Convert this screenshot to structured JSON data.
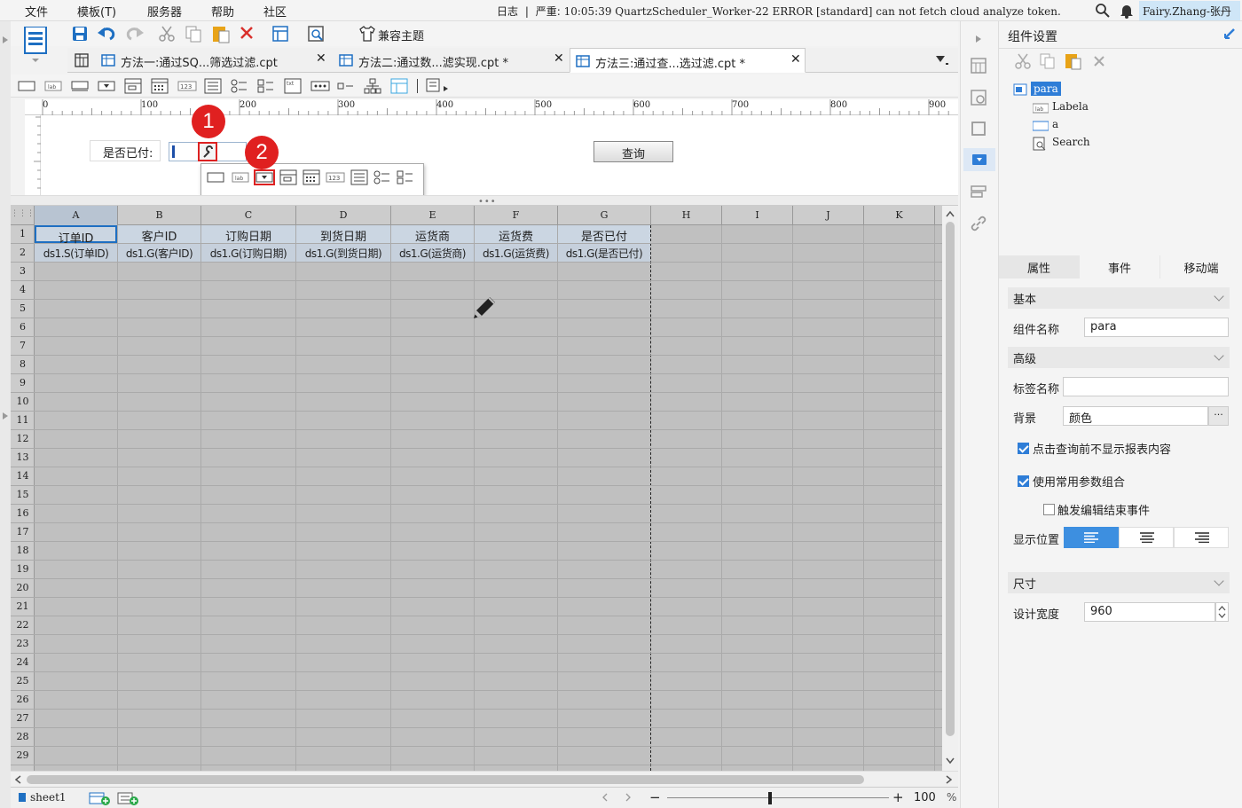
{
  "menubar": {
    "items": [
      "文件",
      "模板(T)",
      "服务器",
      "帮助",
      "社区"
    ],
    "log_label": "日志",
    "severity": "严重:",
    "log_message": "10:05:39 QuartzScheduler_Worker-22 ERROR [standard] can not fetch cloud analyze token.",
    "user": "Fairy.Zhang-张丹"
  },
  "toolbar": {
    "theme_label": "兼容主题"
  },
  "tabs": [
    {
      "label": "方法一:通过SQ...筛选过滤.cpt"
    },
    {
      "label": "方法二:通过数...滤实现.cpt *"
    },
    {
      "label": "方法三:通过查...选过滤.cpt *"
    }
  ],
  "ruler": {
    "marks": [
      "0",
      "100",
      "200",
      "300",
      "400",
      "500",
      "600",
      "700",
      "800",
      "900"
    ]
  },
  "param_area": {
    "label": "是否已付:",
    "query_button": "查询"
  },
  "widget_popup": {
    "row1": [
      "text-box",
      "label",
      "dropdown",
      "multi-select",
      "date",
      "number",
      "list",
      "radio-group",
      "checkbox-group"
    ],
    "row2": [
      "textarea",
      "password",
      "checkbox",
      "tree",
      "table-tree"
    ]
  },
  "badges": [
    "1",
    "2"
  ],
  "grid": {
    "columns": [
      "A",
      "B",
      "C",
      "D",
      "E",
      "F",
      "G",
      "H",
      "I",
      "J",
      "K"
    ],
    "header_row": [
      "订单ID",
      "客户ID",
      "订购日期",
      "到货日期",
      "运货商",
      "运货费",
      "是否已付"
    ],
    "data_row": [
      "ds1.S(订单ID)",
      "ds1.G(客户ID)",
      "ds1.G(订购日期)",
      "ds1.G(到货日期)",
      "ds1.G(运货商)",
      "ds1.G(运货费)",
      "ds1.G(是否已付)"
    ],
    "row_count": 29
  },
  "statusbar": {
    "sheet": "sheet1",
    "zoom": "100",
    "zoom_unit": "%"
  },
  "panel": {
    "title": "组件设置",
    "tree": [
      "para",
      "Labela",
      "a",
      "Search"
    ],
    "tabs": [
      "属性",
      "事件",
      "移动端"
    ],
    "sections": {
      "basic": "基本",
      "advanced": "高级",
      "size": "尺寸"
    },
    "fields": {
      "name_label": "组件名称",
      "name_value": "para",
      "tag_label": "标签名称",
      "tag_value": "",
      "bg_label": "背景",
      "bg_value": "颜色",
      "cb1": "点击查询前不显示报表内容",
      "cb2": "使用常用参数组合",
      "cb3": "触发编辑结束事件",
      "pos_label": "显示位置",
      "width_label": "设计宽度",
      "width_value": "960"
    },
    "checkboxes": [
      true,
      true,
      false
    ]
  },
  "colors": {
    "accent": "#2e7dd7",
    "badge": "#e02020",
    "grid_bg": "#c0c0c0",
    "header_row_bg": "#cbd6e2"
  }
}
